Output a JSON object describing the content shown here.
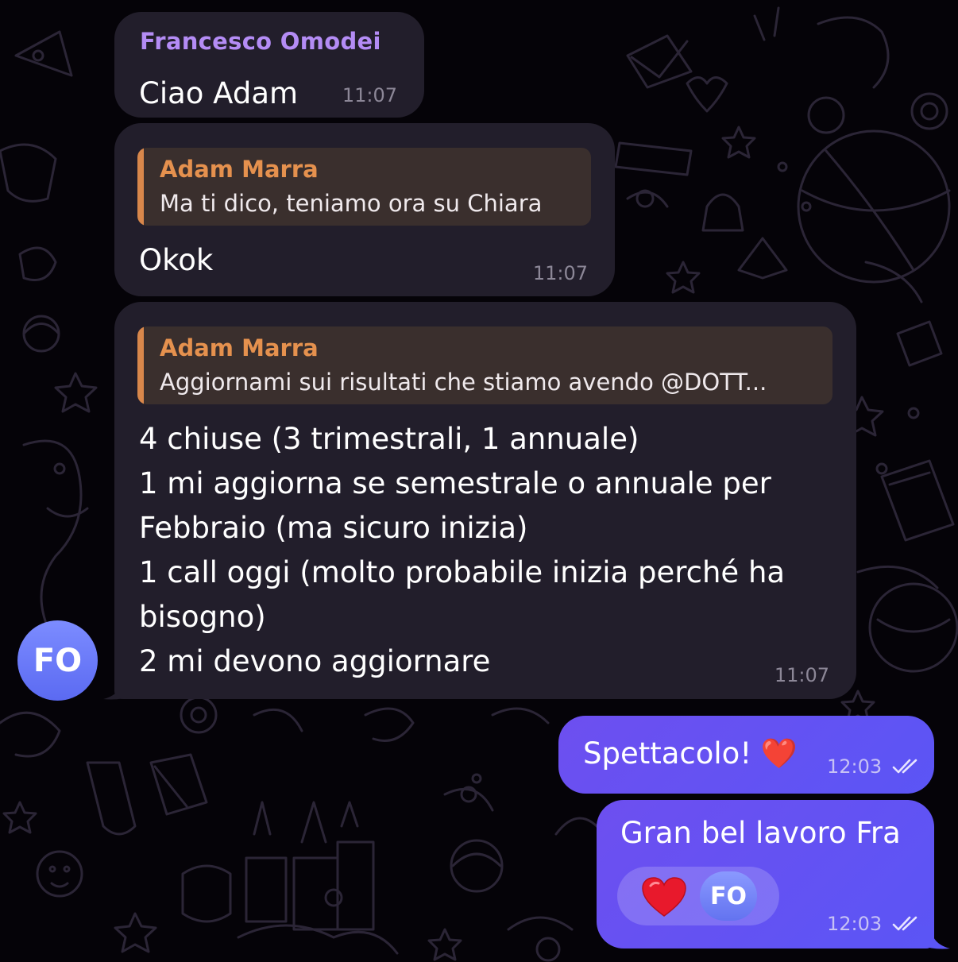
{
  "chat": {
    "messages": [
      {
        "sender": "Francesco Omodei",
        "text": "Ciao Adam",
        "time": "11:07"
      },
      {
        "reply_to": {
          "name": "Adam Marra",
          "text": "Ma ti dico, teniamo ora su Chiara"
        },
        "text": "Okok",
        "time": "11:07"
      },
      {
        "reply_to": {
          "name": "Adam Marra",
          "text": "Aggiornami sui risultati che stiamo avendo @DOTT..."
        },
        "lines": [
          "4 chiuse (3 trimestrali, 1 annuale)",
          "1 mi aggiorna se semestrale o annuale per",
          "Febbraio (ma sicuro inizia)",
          "1 call oggi (molto probabile inizia perché ha",
          "bisogno)",
          "2 mi devono aggiornare"
        ],
        "time": "11:07"
      }
    ],
    "avatar_initials": "FO",
    "outgoing": [
      {
        "text": "Spettacolo! ❤️",
        "time": "12:03",
        "status": "read"
      },
      {
        "text": "Gran bel lavoro Fra",
        "time": "12:03",
        "status": "read",
        "reaction": {
          "emoji": "heart-icon",
          "by": "FO"
        }
      }
    ],
    "colors": {
      "incoming_bubble": "#221e2b",
      "outgoing_bubble": "#6d4ff0",
      "sender_name": "#b48cf5",
      "reply_accent": "#e5914e",
      "avatar": "#6b7bf8"
    }
  }
}
